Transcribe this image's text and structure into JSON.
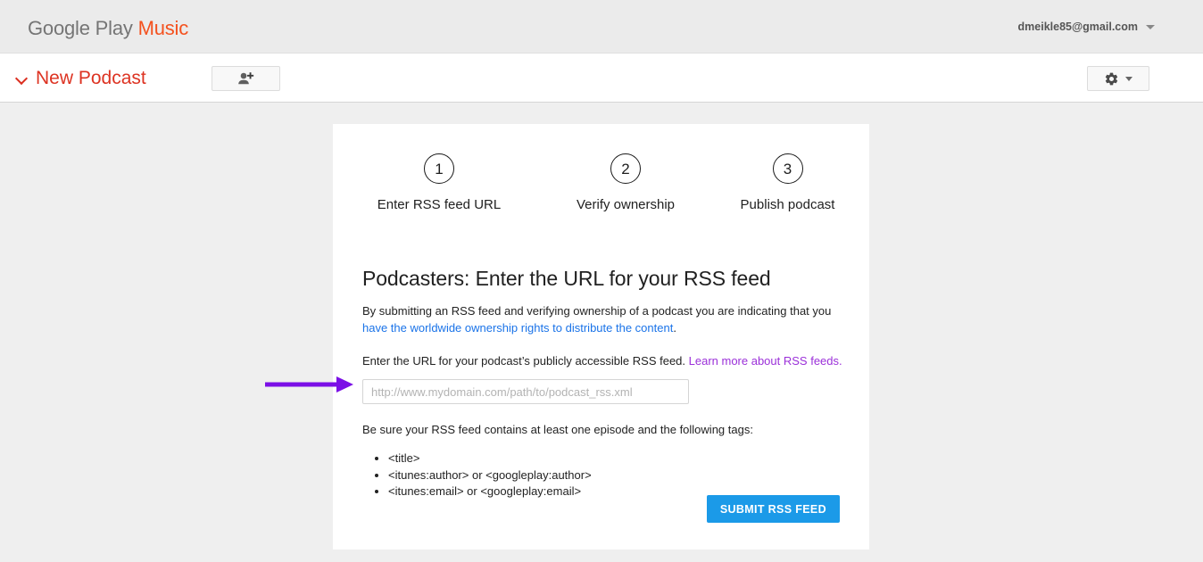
{
  "header": {
    "brand_google": "Google",
    "brand_play": "Play",
    "brand_music": "Music",
    "account_email": "dmeikle85@gmail.com",
    "account_caret_icon": "chevron-down-icon"
  },
  "toolbar": {
    "collapse_icon": "chevron-down-icon",
    "page_title": "New Podcast",
    "add_person_icon": "add-person-icon",
    "gear_icon": "gear-icon",
    "gear_caret_icon": "chevron-down-icon"
  },
  "stepper": {
    "steps": [
      {
        "number": "1",
        "label": "Enter RSS feed URL"
      },
      {
        "number": "2",
        "label": "Verify ownership"
      },
      {
        "number": "3",
        "label": "Publish podcast"
      }
    ]
  },
  "main": {
    "headline": "Podcasters: Enter the URL for your RSS feed",
    "intro_text": "By submitting an RSS feed and verifying ownership of a podcast you are indicating that you ",
    "intro_link": "have the worldwide ownership rights to distribute the content",
    "intro_period": ".",
    "instruction_text": "Enter the URL for your podcast’s publicly accessible RSS feed. ",
    "instruction_link": "Learn more about RSS feeds.",
    "input_placeholder": "http://www.mydomain.com/path/to/podcast_rss.xml",
    "input_value": "",
    "tags_intro": "Be sure your RSS feed contains at least one episode and the following tags:",
    "tags": [
      "<title>",
      "<itunes:author> or <googleplay:author>",
      "<itunes:email> or <googleplay:email>"
    ],
    "submit_label": "SUBMIT RSS FEED"
  },
  "annotation": {
    "arrow_icon": "right-arrow-annotation",
    "arrow_color": "#7b0fe6"
  },
  "colors": {
    "brand_orange": "#f4511e",
    "brand_gray": "#757575",
    "title_red": "#dd3322",
    "link_blue": "#1a73e8",
    "link_purple": "#9b30d9",
    "submit_blue": "#1b9ae8",
    "page_bg": "#efefef",
    "header_bg": "#ebebeb",
    "card_bg": "#ffffff"
  }
}
